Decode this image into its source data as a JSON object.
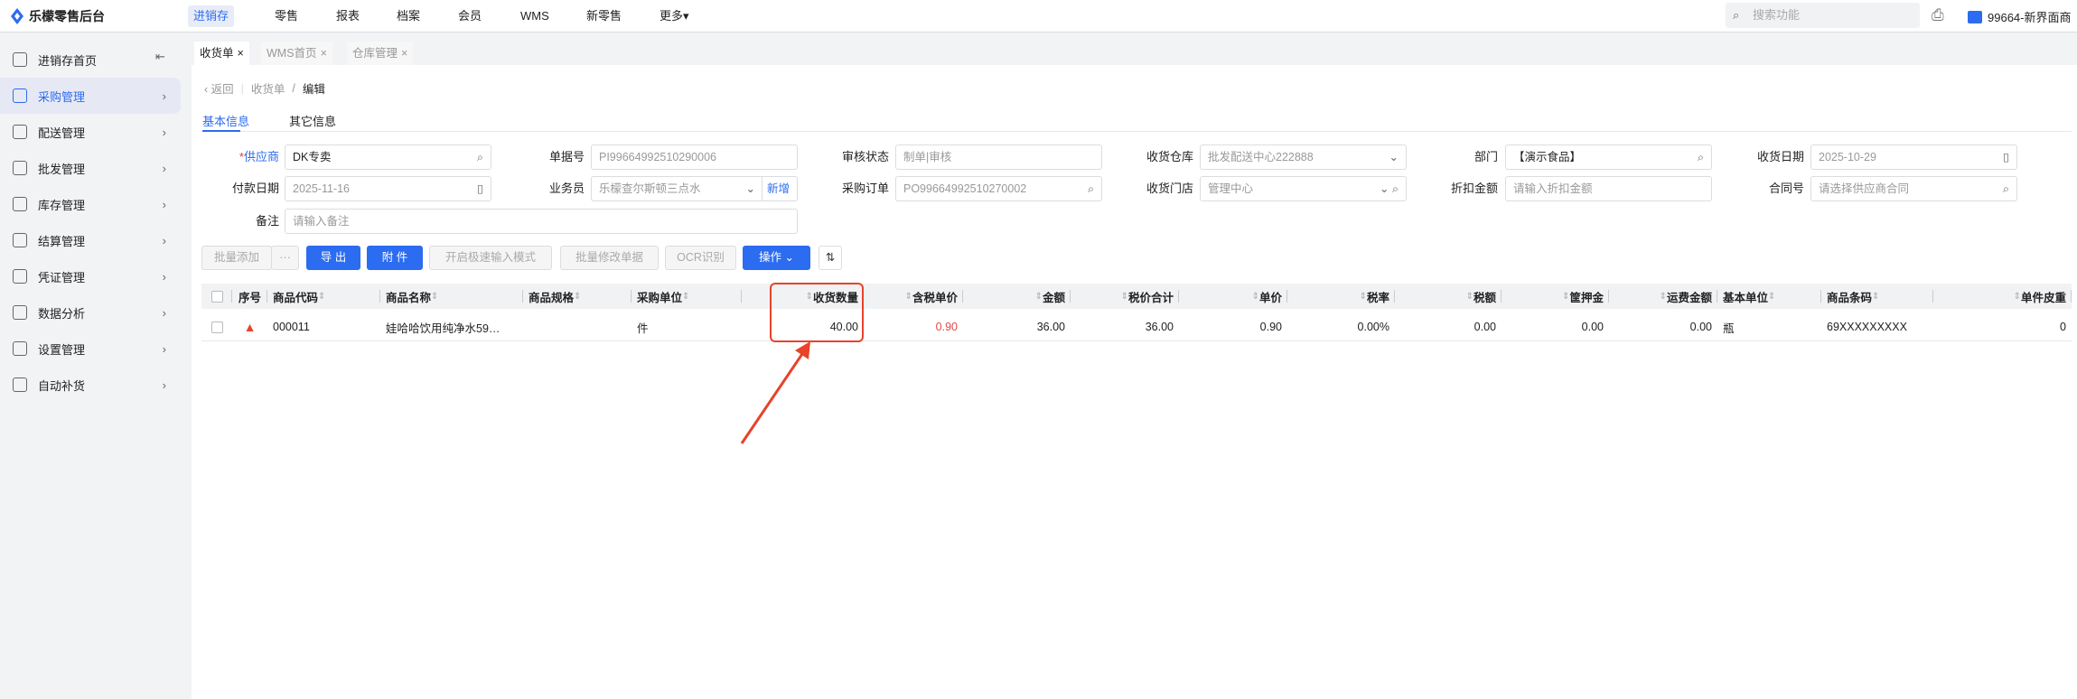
{
  "app": {
    "title": "乐檬零售后台"
  },
  "topnav": [
    {
      "label": "进销存",
      "active": true
    },
    {
      "label": "零售"
    },
    {
      "label": "报表"
    },
    {
      "label": "档案"
    },
    {
      "label": "会员"
    },
    {
      "label": "WMS"
    },
    {
      "label": "新零售"
    },
    {
      "label": "更多"
    }
  ],
  "search": {
    "placeholder": "搜索功能"
  },
  "store": {
    "label": "99664-新界面商"
  },
  "sidebar": {
    "items": [
      {
        "label": "进销存首页",
        "icon": "home-icon"
      },
      {
        "label": "采购管理",
        "icon": "cart-icon",
        "active": true
      },
      {
        "label": "配送管理",
        "icon": "map-icon"
      },
      {
        "label": "批发管理",
        "icon": "server-icon"
      },
      {
        "label": "库存管理",
        "icon": "box-icon"
      },
      {
        "label": "结算管理",
        "icon": "dollar-icon"
      },
      {
        "label": "凭证管理",
        "icon": "document-icon"
      },
      {
        "label": "数据分析",
        "icon": "chart-icon"
      },
      {
        "label": "设置管理",
        "icon": "settings-icon"
      },
      {
        "label": "自动补货",
        "icon": "basket-icon"
      }
    ]
  },
  "tabs": [
    {
      "label": "收货单",
      "active": true
    },
    {
      "label": "WMS首页"
    },
    {
      "label": "仓库管理"
    }
  ],
  "breadcrumb": {
    "back": "返回",
    "parent": "收货单",
    "current": "编辑"
  },
  "subtabs": [
    {
      "label": "基本信息",
      "active": true
    },
    {
      "label": "其它信息"
    }
  ],
  "form": {
    "supplier": {
      "label": "供应商",
      "value": "DK专卖"
    },
    "doc_no": {
      "label": "单据号",
      "value": "PI99664992510290006"
    },
    "audit_status": {
      "label": "审核状态",
      "value": "制单|审核"
    },
    "warehouse": {
      "label": "收货仓库",
      "value": "批发配送中心222888"
    },
    "department": {
      "label": "部门",
      "value": "【演示食品】"
    },
    "receive_date": {
      "label": "收货日期",
      "value": "2025-10-29"
    },
    "pay_date": {
      "label": "付款日期",
      "value": "2025-11-16"
    },
    "salesman": {
      "label": "业务员",
      "value": "乐檬查尔斯顿三点水",
      "add": "新增"
    },
    "purchase_order": {
      "label": "采购订单",
      "value": "PO99664992510270002"
    },
    "store": {
      "label": "收货门店",
      "value": "管理中心"
    },
    "discount": {
      "label": "折扣金额",
      "placeholder": "请输入折扣金额"
    },
    "contract": {
      "label": "合同号",
      "placeholder": "请选择供应商合同"
    },
    "remark": {
      "label": "备注",
      "placeholder": "请输入备注"
    }
  },
  "toolbar": {
    "batch_add": "批量添加",
    "more": "···",
    "export": "导 出",
    "attach": "附 件",
    "fast_mode": "开启极速输入模式",
    "batch_edit": "批量修改单据",
    "ocr": "OCR识别",
    "ops": "操作"
  },
  "table": {
    "headers": [
      "序号",
      "商品代码",
      "商品名称",
      "商品规格",
      "采购单位",
      "收货数量",
      "含税单价",
      "金额",
      "税价合计",
      "单价",
      "税率",
      "税额",
      "筐押金",
      "运费金额",
      "基本单位",
      "商品条码",
      "单件皮重"
    ],
    "rows": [
      {
        "seq_icon": "warning-icon",
        "cells": [
          "",
          "000011",
          "娃哈哈饮用纯净水59…",
          "",
          "件",
          "40.00",
          "0.90",
          "36.00",
          "36.00",
          "0.90",
          "0.00%",
          "0.00",
          "0.00",
          "0.00",
          "瓶",
          "69XXXXXXXXX",
          "0"
        ]
      }
    ]
  },
  "colors": {
    "accent": "#2c6cf0",
    "highlight": "#e8432b",
    "price": "#e04b4b"
  }
}
